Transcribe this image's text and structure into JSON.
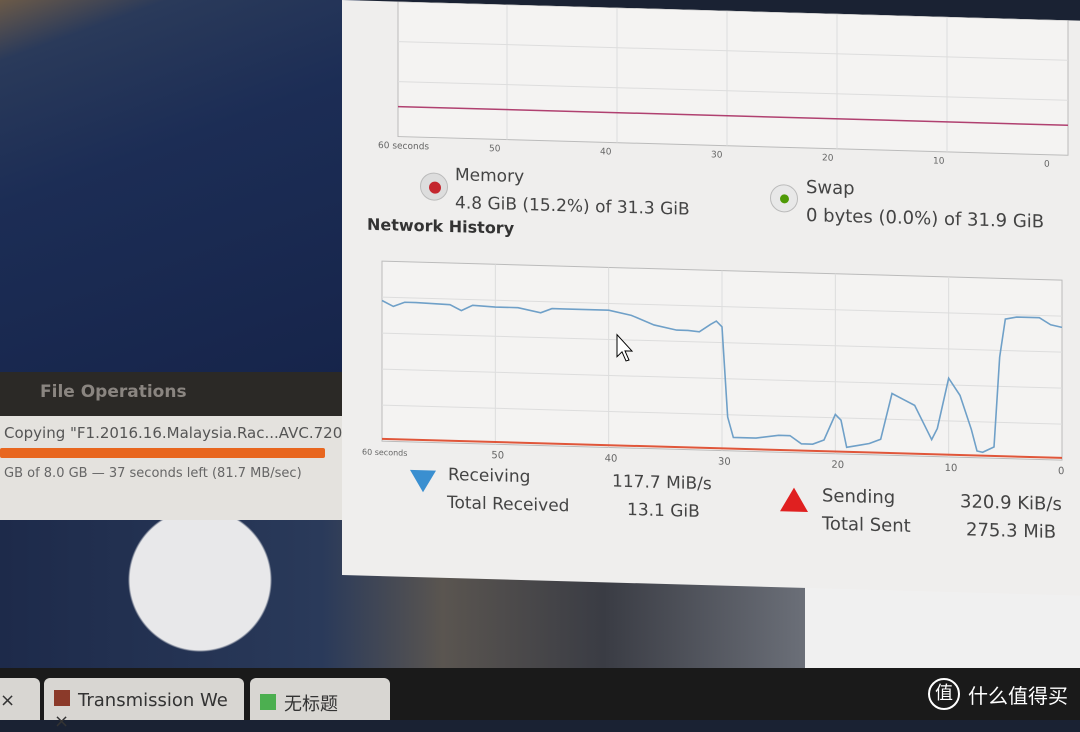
{
  "file_operations": {
    "title": "File Operations",
    "filename": "Copying \"F1.2016.16.Malaysia.Rac...AVC.720p.",
    "progress_percent": 95,
    "status": "GB of 8.0 GB — 37 seconds left (81.7 MB/sec)"
  },
  "monitor": {
    "cpu_axis": {
      "x_ticks": [
        "60 seconds",
        "50",
        "40",
        "30",
        "20",
        "10",
        "0"
      ]
    },
    "memory": {
      "label": "Memory",
      "value": "4.8 GiB (15.2%) of 31.3 GiB",
      "color": "#c4262e"
    },
    "swap": {
      "label": "Swap",
      "value": "0 bytes (0.0%) of 31.9 GiB",
      "color": "#4e9a06"
    },
    "network": {
      "title": "Network History",
      "x_ticks": [
        "60 seconds",
        "50",
        "40",
        "30",
        "20",
        "10",
        "0"
      ],
      "receiving_label": "Receiving",
      "receiving_rate": "117.7 MiB/s",
      "total_received_label": "Total Received",
      "total_received": "13.1 GiB",
      "sending_label": "Sending",
      "sending_rate": "320.9 KiB/s",
      "total_sent_label": "Total Sent",
      "total_sent": "275.3 MiB",
      "receiving_color": "#3465a4",
      "sending_color": "#cc0000"
    }
  },
  "chart_data": {
    "type": "line",
    "xlabel": "",
    "ylabel": "",
    "x_ticks": [
      "60 seconds",
      "50",
      "40",
      "30",
      "20",
      "10",
      "0"
    ],
    "xlim": [
      60,
      0
    ],
    "ylim": [
      0,
      160
    ],
    "grid": true,
    "series": [
      {
        "name": "Receiving",
        "color": "#6fa0c8",
        "x": [
          60,
          59,
          58,
          57,
          54,
          53,
          52,
          50,
          48,
          46,
          45,
          44,
          42,
          40,
          38,
          36,
          34,
          33,
          32,
          31,
          30.5,
          30,
          29.5,
          29,
          27,
          25,
          24,
          23,
          22,
          21,
          20,
          19.5,
          19,
          18,
          17,
          16,
          15,
          14,
          13,
          12,
          11.5,
          11,
          10,
          9,
          8,
          7.5,
          7,
          6,
          5.5,
          5,
          4,
          2,
          1,
          0
        ],
        "y": [
          125,
          120,
          124,
          124,
          123,
          118,
          123,
          122,
          122,
          118,
          122,
          122,
          122,
          122,
          118,
          110,
          106,
          106,
          105,
          112,
          115,
          110,
          30,
          12,
          12,
          15,
          15,
          8,
          8,
          12,
          35,
          30,
          6,
          8,
          10,
          14,
          55,
          50,
          45,
          25,
          15,
          25,
          70,
          55,
          25,
          6,
          5,
          10,
          90,
          124,
          126,
          126,
          120,
          118
        ]
      },
      {
        "name": "Sending",
        "color": "#e0563a",
        "x": [
          60,
          0
        ],
        "y": [
          2,
          2
        ]
      }
    ]
  },
  "tabs": [
    {
      "label": "Transmission We"
    },
    {
      "label": "无标题"
    }
  ],
  "watermark": "什么值得买"
}
